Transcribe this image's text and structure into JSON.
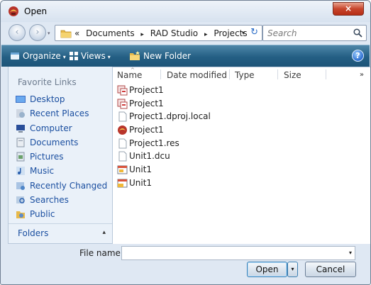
{
  "window": {
    "title": "Open",
    "close_glyph": "×"
  },
  "address": {
    "back_glyph": "‹",
    "forward_glyph": "›",
    "overflow": "«",
    "crumbs": [
      "Documents",
      "RAD Studio",
      "Projects"
    ],
    "crumb_separator": "▸",
    "dropdown_glyph": "▾",
    "refresh_glyph": "↻"
  },
  "search": {
    "placeholder": "Search",
    "icon": "search-icon"
  },
  "toolbar": {
    "organize_label": "Organize",
    "views_label": "Views",
    "new_folder_label": "New Folder",
    "caret": "▾",
    "help_glyph": "?"
  },
  "nav": {
    "favorites_title": "Favorite Links",
    "items": [
      {
        "label": "Desktop",
        "icon": "desktop-icon"
      },
      {
        "label": "Recent Places",
        "icon": "recent-places-icon"
      },
      {
        "label": "Computer",
        "icon": "computer-icon"
      },
      {
        "label": "Documents",
        "icon": "documents-icon"
      },
      {
        "label": "Pictures",
        "icon": "pictures-icon"
      },
      {
        "label": "Music",
        "icon": "music-icon"
      },
      {
        "label": "Recently Changed",
        "icon": "recently-changed-icon"
      },
      {
        "label": "Searches",
        "icon": "searches-icon"
      },
      {
        "label": "Public",
        "icon": "public-icon"
      }
    ],
    "folders_label": "Folders",
    "folders_caret": "▴"
  },
  "filelist": {
    "columns": [
      "Name",
      "Date modified",
      "Type",
      "Size"
    ],
    "more_columns": "»",
    "rows": [
      {
        "name": "Project1",
        "icon": "project-group-icon"
      },
      {
        "name": "Project1",
        "icon": "project-group-icon"
      },
      {
        "name": "Project1.dproj.local",
        "icon": "blank-file-icon"
      },
      {
        "name": "Project1",
        "icon": "delphi-project-icon"
      },
      {
        "name": "Project1.res",
        "icon": "blank-file-icon"
      },
      {
        "name": "Unit1.dcu",
        "icon": "blank-file-icon"
      },
      {
        "name": "Unit1",
        "icon": "form-file-icon"
      },
      {
        "name": "Unit1",
        "icon": "unit-file-icon"
      }
    ]
  },
  "filename": {
    "label": "File name:",
    "value": "",
    "dropdown_glyph": "▾"
  },
  "buttons": {
    "open_label": "Open",
    "open_drop_glyph": "▾",
    "cancel_label": "Cancel"
  }
}
